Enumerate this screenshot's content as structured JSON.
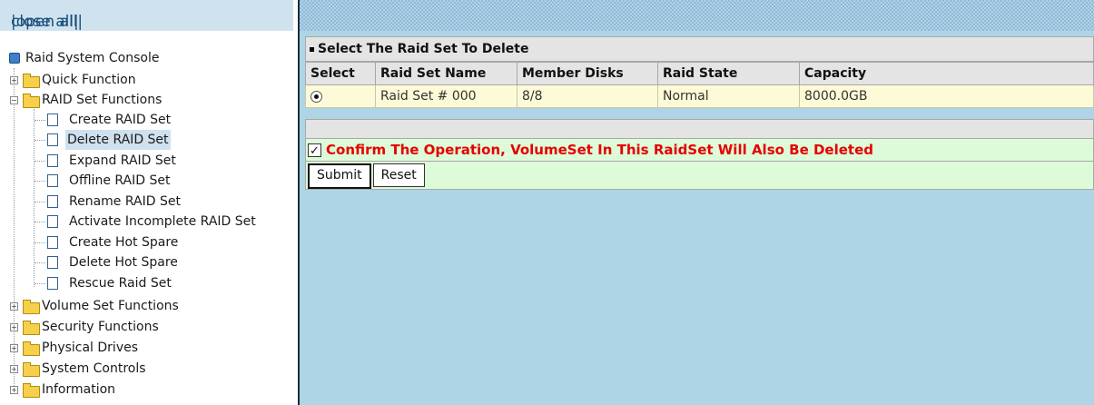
{
  "nav": {
    "open_all": "|open all|",
    "close_all": "close all|",
    "root": "Raid System Console",
    "items": [
      {
        "label": "Quick Function",
        "type": "folder"
      },
      {
        "label": "RAID Set Functions",
        "type": "folder-open"
      },
      {
        "label": "Create RAID Set",
        "type": "page"
      },
      {
        "label": "Delete RAID Set",
        "type": "page",
        "selected": true
      },
      {
        "label": "Expand RAID Set",
        "type": "page"
      },
      {
        "label": "Offline RAID Set",
        "type": "page"
      },
      {
        "label": "Rename RAID Set",
        "type": "page"
      },
      {
        "label": "Activate Incomplete RAID Set",
        "type": "page"
      },
      {
        "label": "Create Hot Spare",
        "type": "page"
      },
      {
        "label": "Delete Hot Spare",
        "type": "page"
      },
      {
        "label": "Rescue Raid Set",
        "type": "page"
      },
      {
        "label": "Volume Set Functions",
        "type": "folder"
      },
      {
        "label": "Security Functions",
        "type": "folder"
      },
      {
        "label": "Physical Drives",
        "type": "folder"
      },
      {
        "label": "System Controls",
        "type": "folder"
      },
      {
        "label": "Information",
        "type": "folder"
      }
    ]
  },
  "panel": {
    "title": "Select The Raid Set To Delete",
    "columns": [
      "Select",
      "Raid Set Name",
      "Member Disks",
      "Raid State",
      "Capacity"
    ],
    "rows": [
      {
        "name": "Raid Set # 000",
        "disks": "8/8",
        "state": "Normal",
        "capacity": "8000.0GB",
        "selected": true
      }
    ],
    "confirm_label": "Confirm The Operation, VolumeSet In This RaidSet Will Also Be Deleted",
    "confirm_checked": true,
    "submit_label": "Submit",
    "reset_label": "Reset"
  },
  "colors": {
    "nav_header_bg": "#cfe3ef",
    "content_bg": "#afd4e6",
    "confirm_text": "#e60000",
    "row_bg": "#fdfbd7",
    "action_bg": "#ddfbd9"
  }
}
